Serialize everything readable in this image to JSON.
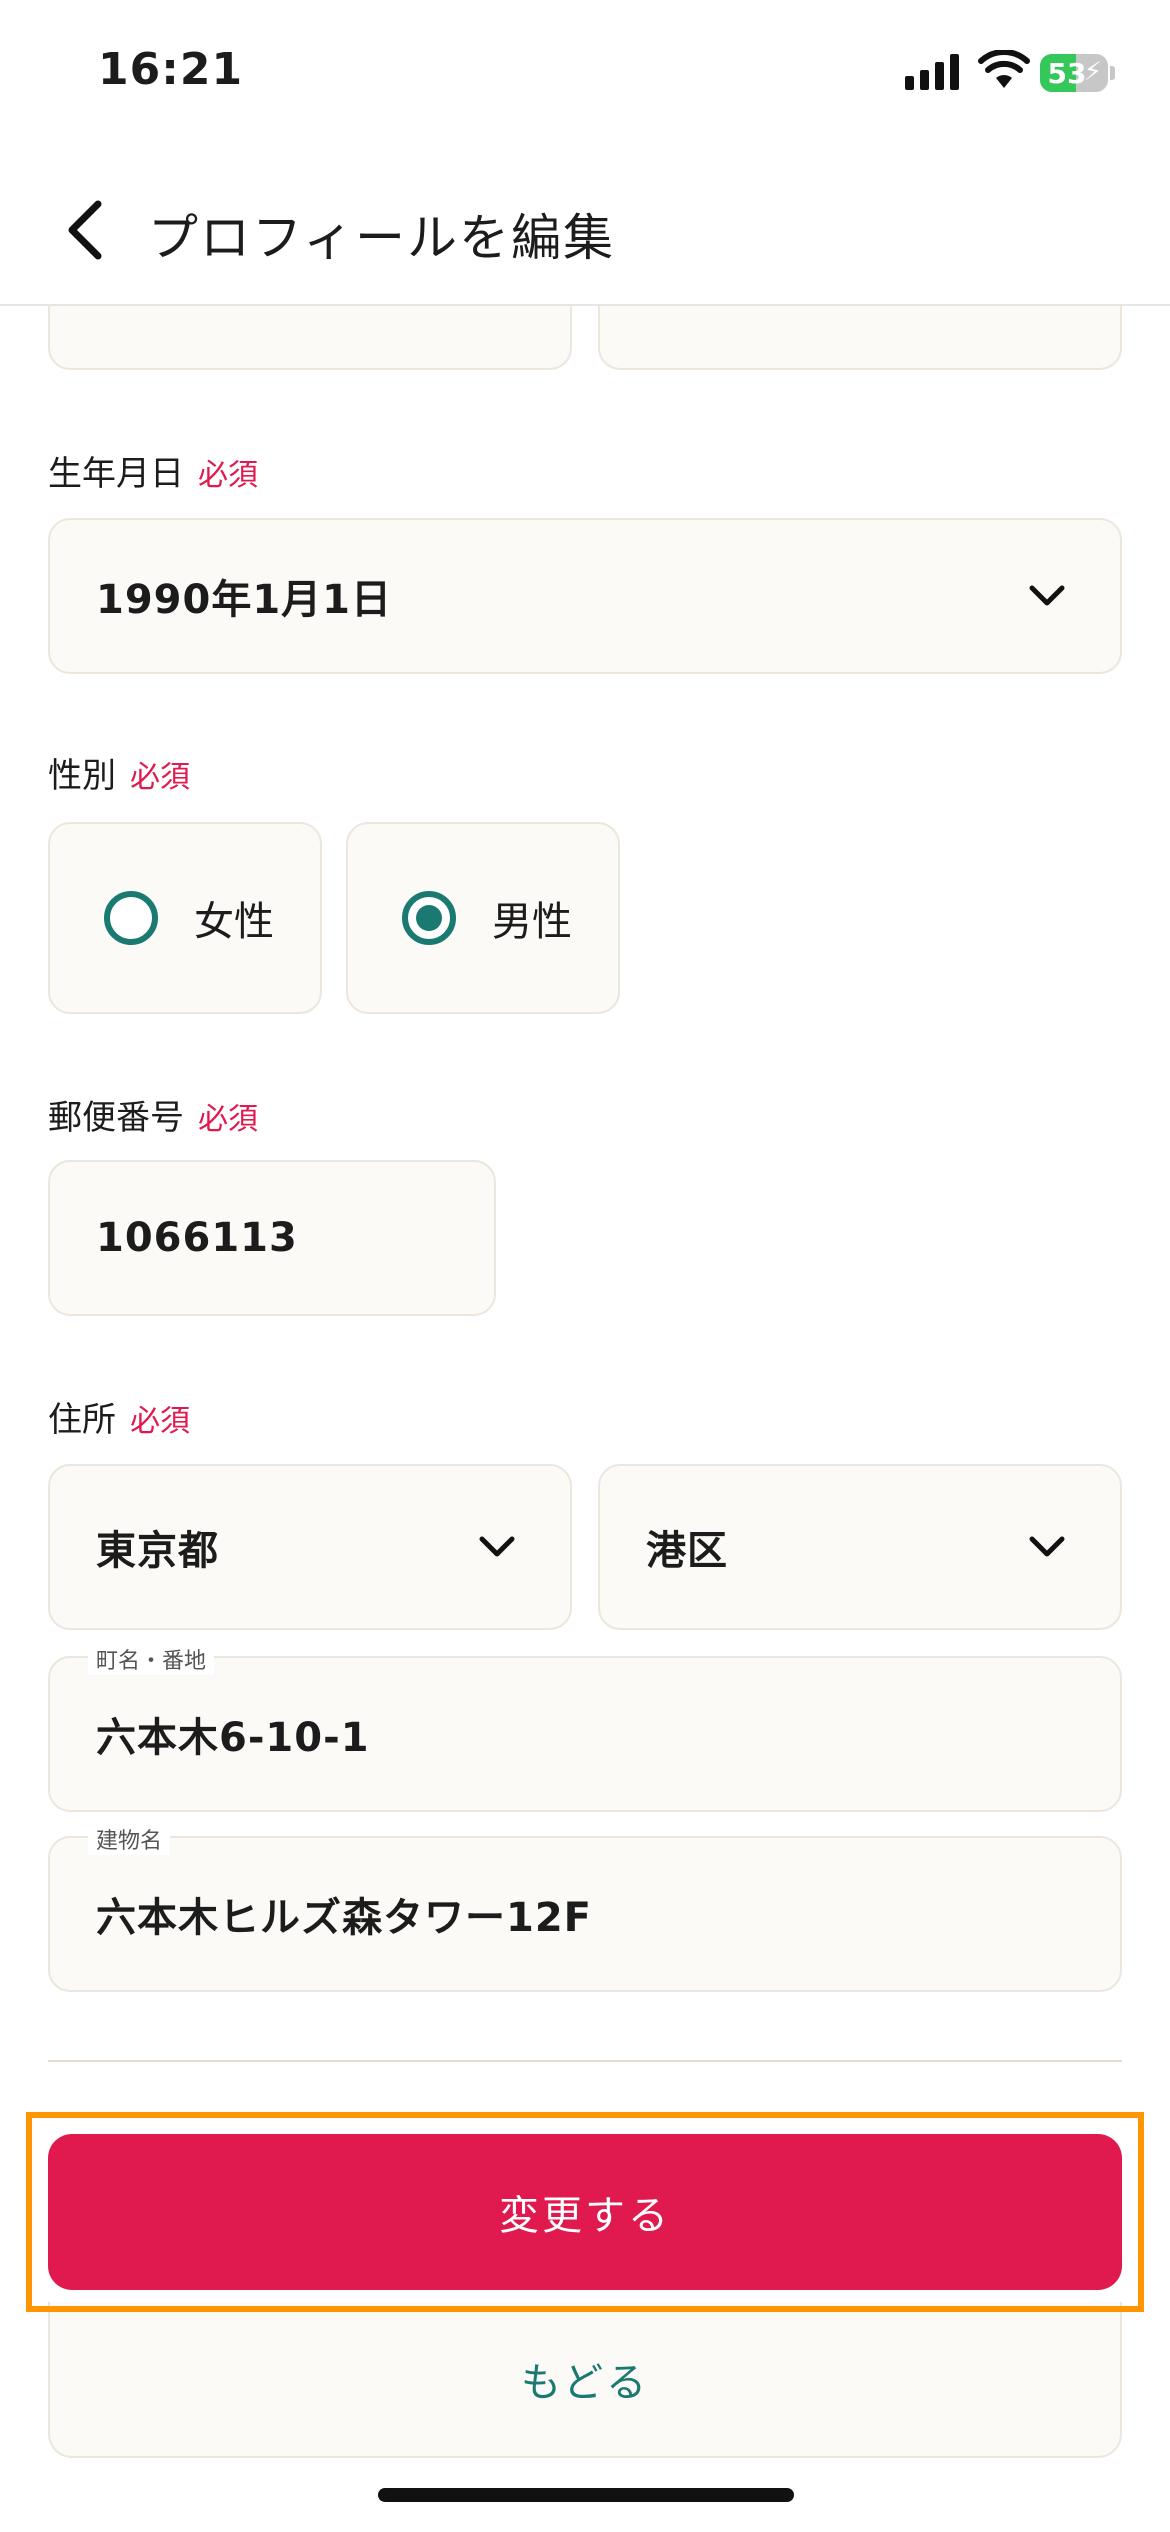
{
  "status_bar": {
    "time": "16:21",
    "battery_percent": "53",
    "battery_level": 0.53
  },
  "header": {
    "title": "プロフィールを編集"
  },
  "required_label": "必須",
  "birthdate": {
    "label": "生年月日",
    "value": "1990年1月1日"
  },
  "gender": {
    "label": "性別",
    "options": [
      {
        "label": "女性",
        "selected": false
      },
      {
        "label": "男性",
        "selected": true
      }
    ]
  },
  "postal_code": {
    "label": "郵便番号",
    "value": "1066113"
  },
  "address": {
    "label": "住所",
    "prefecture": "東京都",
    "city": "港区",
    "street": {
      "label": "町名・番地",
      "value": "六本木6-10-1"
    },
    "building": {
      "label": "建物名",
      "value": "六本木ヒルズ森タワー12F"
    }
  },
  "actions": {
    "submit": "変更する",
    "back": "もどる"
  },
  "colors": {
    "accent": "#e01a4f",
    "teal": "#1a7a72",
    "highlight": "#ff9500"
  }
}
